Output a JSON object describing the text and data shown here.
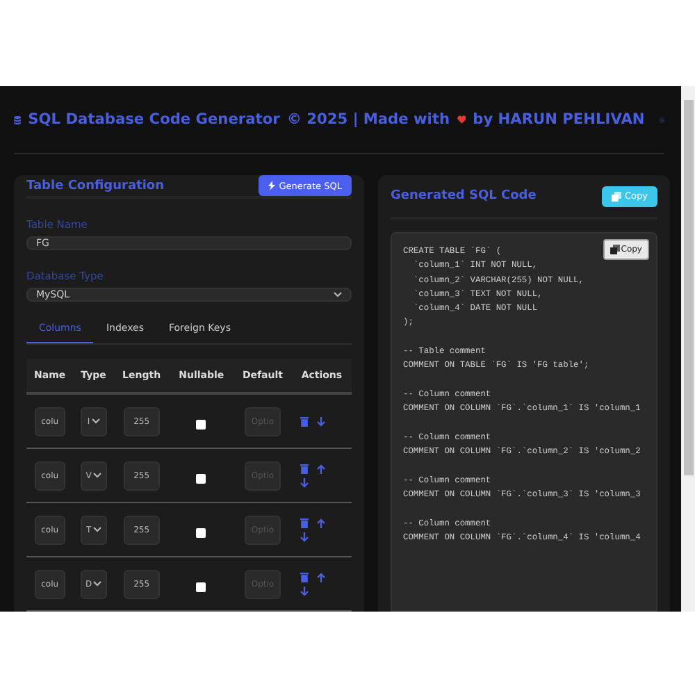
{
  "header": {
    "title": "SQL Database Code Generator",
    "credit_before": "© 2025 | Made with",
    "credit_after": "by HARUN PEHLIVAN"
  },
  "config": {
    "title": "Table Configuration",
    "generate_button": "Generate SQL",
    "table_name_label": "Table Name",
    "table_name": "FG",
    "db_type_label": "Database Type",
    "db_type": "MySQL",
    "tabs": [
      {
        "label": "Columns",
        "selected": true
      },
      {
        "label": "Indexes",
        "selected": false
      },
      {
        "label": "Foreign Keys",
        "selected": false
      }
    ],
    "columns": [
      "Name",
      "Type",
      "Length",
      "Nullable",
      "Default",
      "Actions"
    ],
    "rows": [
      {
        "name": "colu",
        "type": "I",
        "length": "255",
        "nullable": false,
        "default_placeholder": "Optio",
        "can_move_up": false,
        "can_move_down": true
      },
      {
        "name": "colu",
        "type": "V",
        "length": "255",
        "nullable": false,
        "default_placeholder": "Optio",
        "can_move_up": true,
        "can_move_down": true
      },
      {
        "name": "colu",
        "type": "T",
        "length": "255",
        "nullable": false,
        "default_placeholder": "Optio",
        "can_move_up": true,
        "can_move_down": true
      },
      {
        "name": "colu",
        "type": "D",
        "length": "255",
        "nullable": false,
        "default_placeholder": "Optio",
        "can_move_up": true,
        "can_move_down": true
      }
    ]
  },
  "output": {
    "title": "Generated SQL Code",
    "copy_button": "Copy",
    "inner_copy_button": "Copy",
    "code_blocks": [
      [
        "CREATE TABLE `FG` (",
        "  `column_1` INT NOT NULL,",
        "  `column_2` VARCHAR(255) NOT NULL,",
        "  `column_3` TEXT NOT NULL,",
        "  `column_4` DATE NOT NULL",
        ");"
      ],
      [
        "-- Table comment",
        "COMMENT ON TABLE `FG` IS 'FG table';"
      ],
      [
        "-- Column comment",
        "COMMENT ON COLUMN `FG`.`column_1` IS 'column_1"
      ],
      [
        "-- Column comment",
        "COMMENT ON COLUMN `FG`.`column_2` IS 'column_2"
      ],
      [
        "-- Column comment",
        "COMMENT ON COLUMN `FG`.`column_3` IS 'column_3"
      ],
      [
        "-- Column comment",
        "COMMENT ON COLUMN `FG`.`column_4` IS 'column_4"
      ]
    ]
  }
}
